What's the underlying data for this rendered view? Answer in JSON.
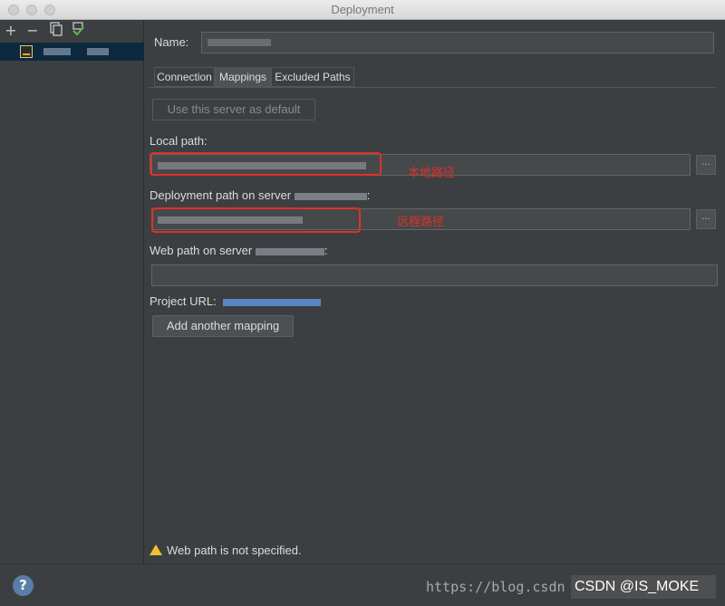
{
  "window": {
    "title": "Deployment"
  },
  "sidebar": {
    "toolbar": {
      "add": "+",
      "remove": "−"
    }
  },
  "form": {
    "name_label": "Name:",
    "tabs": [
      {
        "label": "Connection",
        "active": false
      },
      {
        "label": "Mappings",
        "active": true
      },
      {
        "label": "Excluded Paths",
        "active": false
      }
    ],
    "use_default_label": "Use this server as default",
    "local_path_label": "Local path:",
    "deployment_path_label": "Deployment path on server",
    "web_path_label": "Web path on server",
    "colon": ":",
    "browse_label": "...",
    "project_url_label": "Project URL:",
    "add_mapping_label": "Add another mapping",
    "warning_text": "Web path is not specified."
  },
  "annotations": {
    "local_note": "本地路径",
    "remote_note": "远程路径",
    "color": "#e0302a"
  },
  "footer": {
    "help": "?",
    "watermark": "https://blog.csdn",
    "csdn_badge": "CSDN @IS_MOKE"
  }
}
